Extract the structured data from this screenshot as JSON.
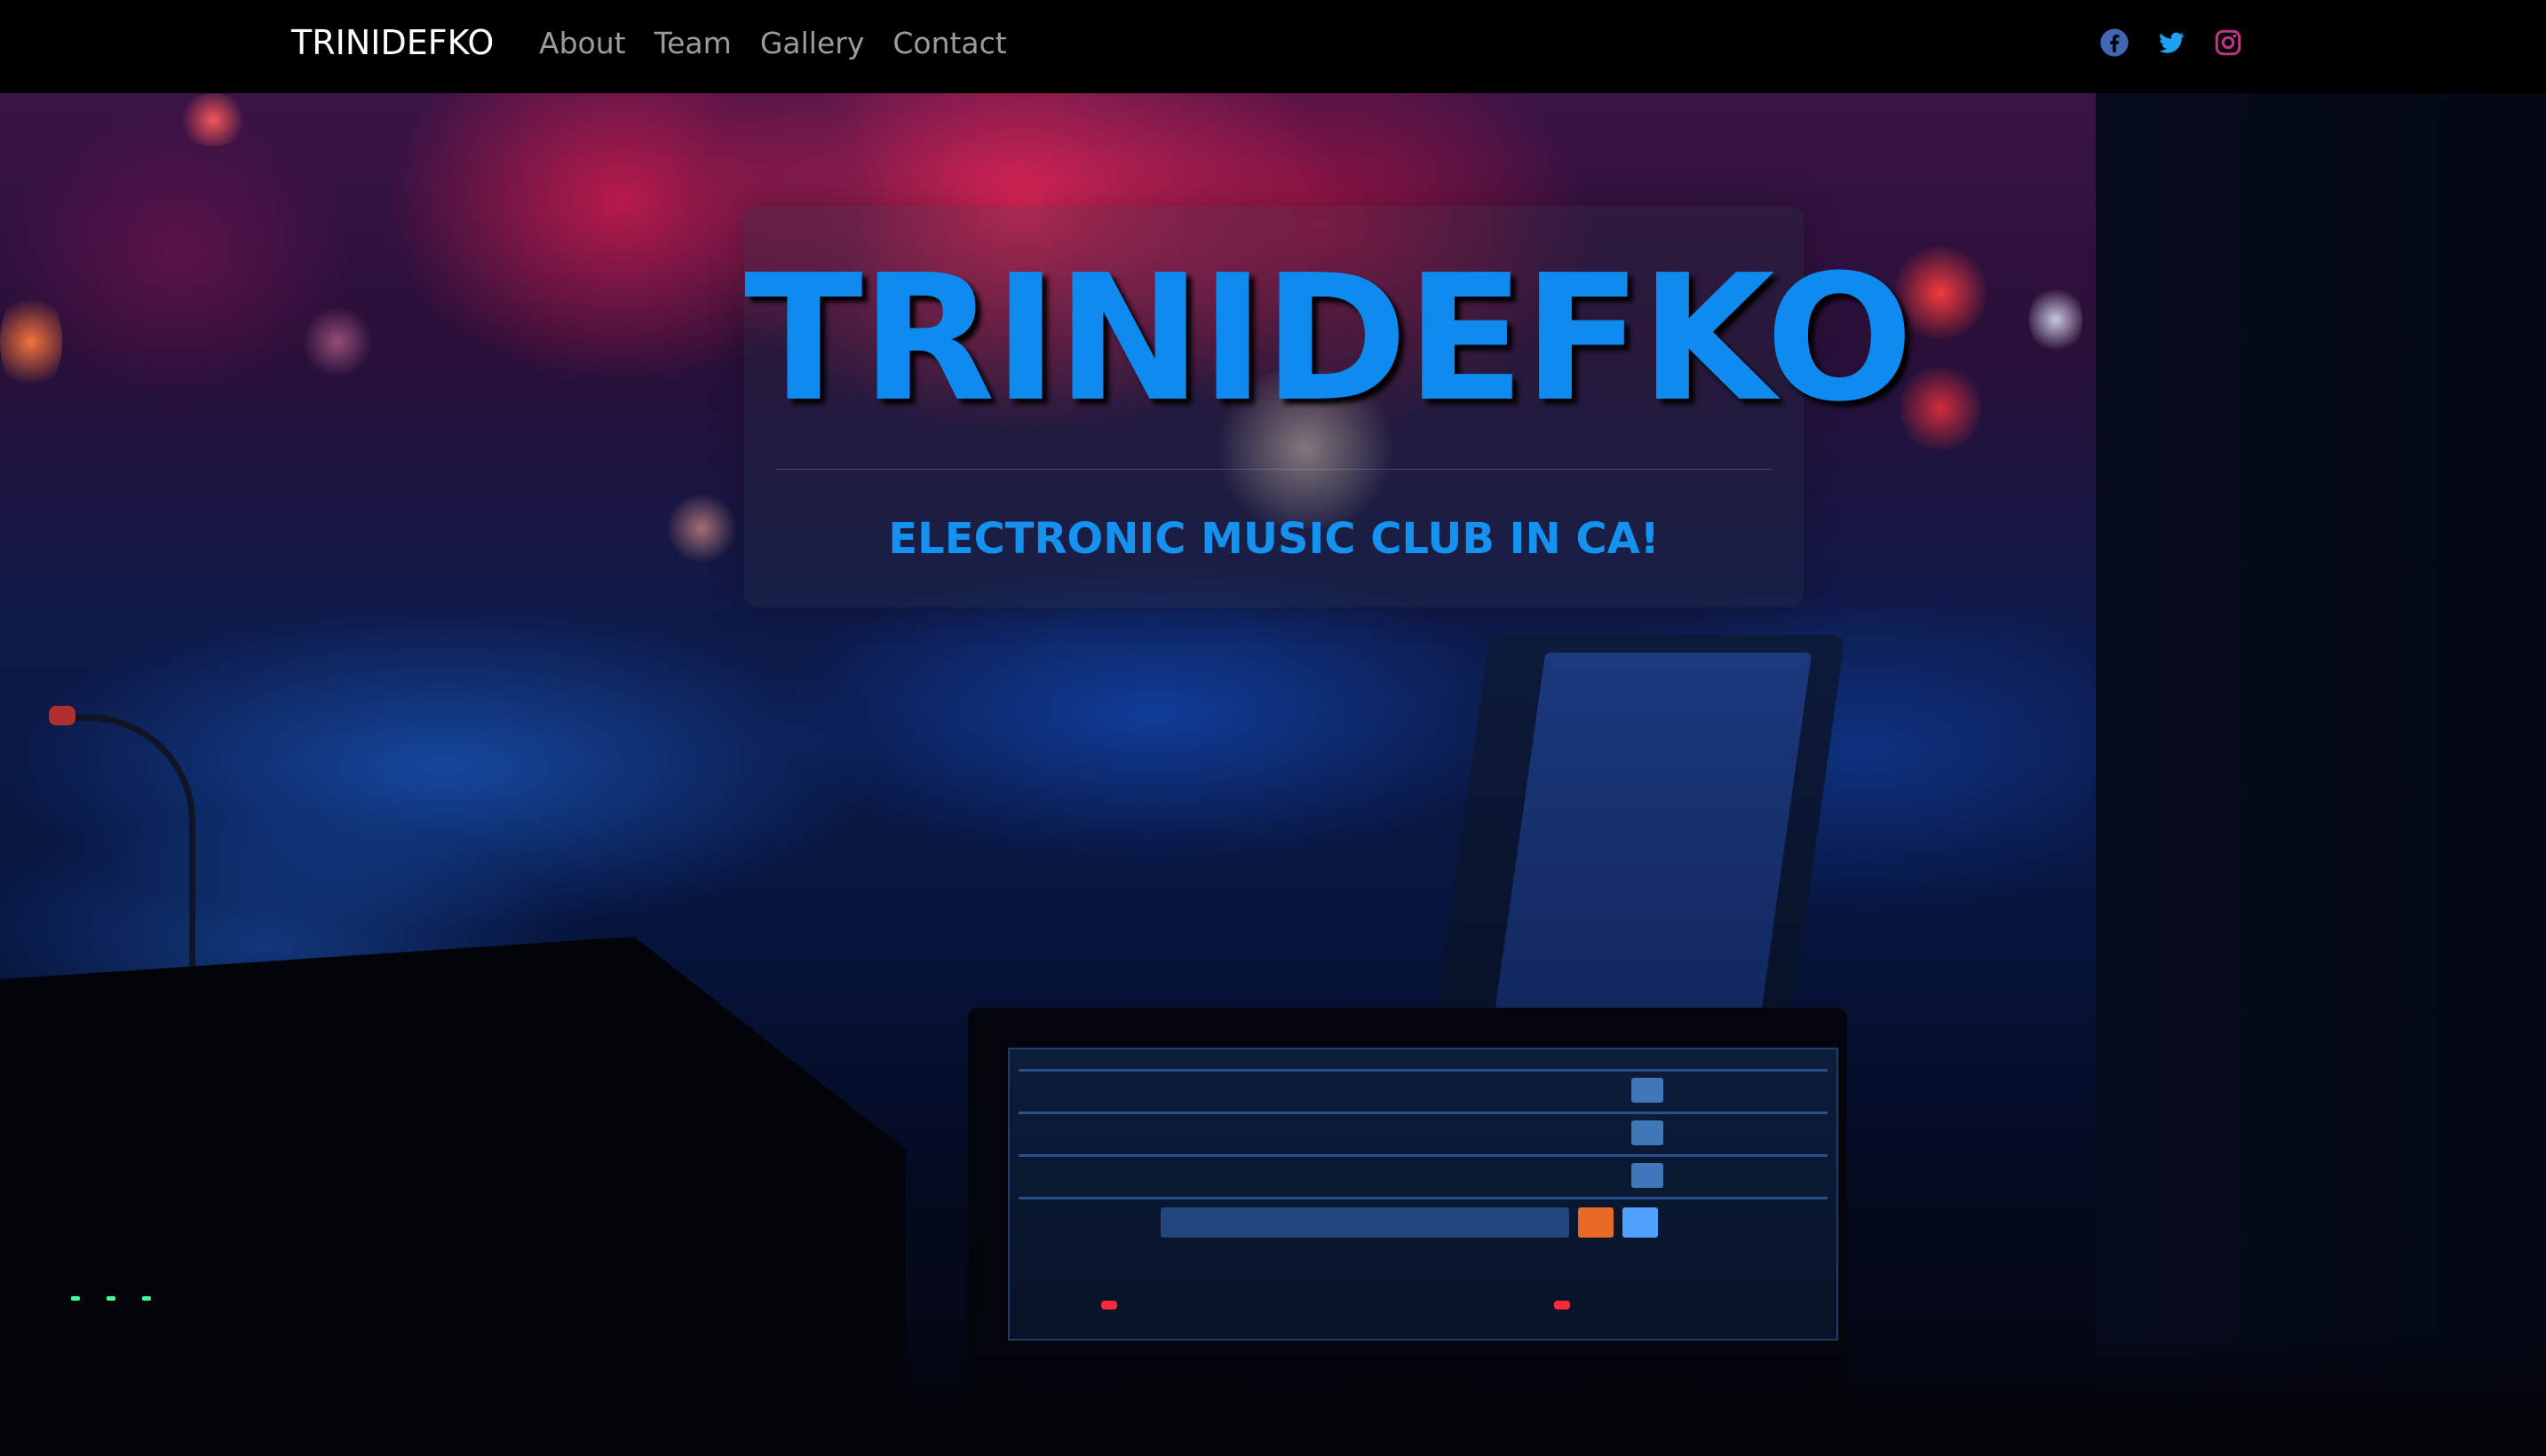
{
  "navbar": {
    "brand": "TRINIDEFKO",
    "links": [
      {
        "label": "About"
      },
      {
        "label": "Team"
      },
      {
        "label": "Gallery"
      },
      {
        "label": "Contact"
      }
    ],
    "social": [
      {
        "icon": "facebook-icon",
        "color": "#4267b2"
      },
      {
        "icon": "twitter-icon",
        "color": "#1da1f2"
      },
      {
        "icon": "instagram-icon",
        "color": "#c13584"
      }
    ]
  },
  "hero": {
    "title": "TRINIDEFKO",
    "subtitle": "ELECTRONIC MUSIC CLUB IN CA!",
    "accent_color": "#0f8aee"
  }
}
